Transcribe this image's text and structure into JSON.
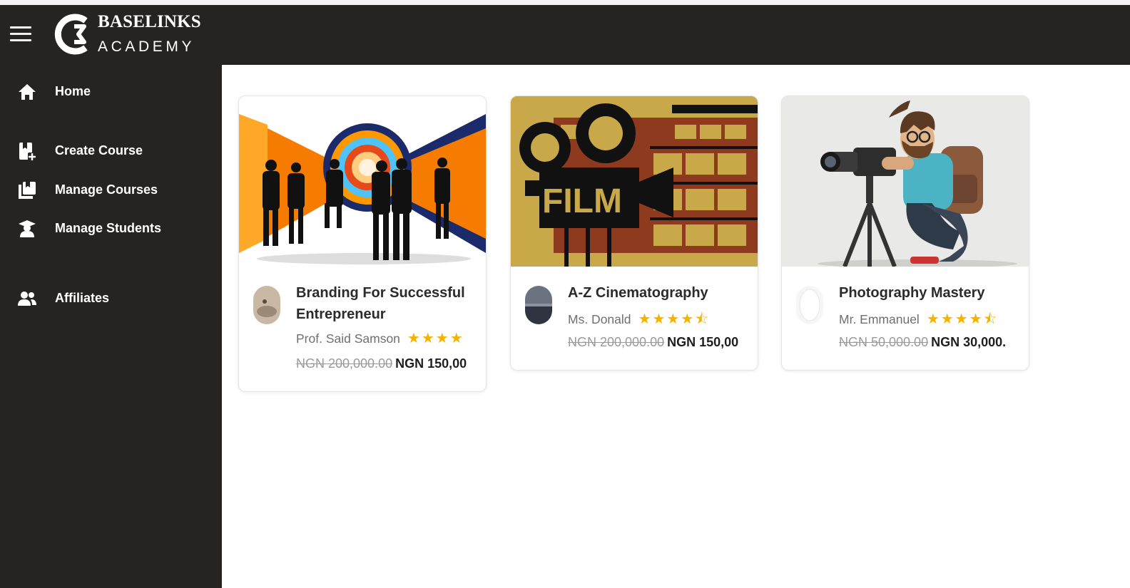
{
  "brand": {
    "line1": "BASELINKS",
    "line2": "ACADEMY"
  },
  "sidebar": {
    "items": [
      {
        "label": "Home",
        "icon": "home-icon"
      },
      {
        "label": "Create Course",
        "icon": "create-course-icon"
      },
      {
        "label": "Manage Courses",
        "icon": "manage-courses-icon"
      },
      {
        "label": "Manage Students",
        "icon": "manage-students-icon"
      },
      {
        "label": "Affiliates",
        "icon": "affiliates-icon"
      }
    ]
  },
  "courses": [
    {
      "title": "Branding For Successful Entrepreneur",
      "instructor": "Prof. Said Samson",
      "stars": "★★★★",
      "old_price": "NGN 200,000.00",
      "new_price": "NGN 150,00"
    },
    {
      "title": "A-Z Cinematography",
      "instructor": "Ms. Donald",
      "stars": "★★★★⯪",
      "old_price": "NGN 200,000.00",
      "new_price": "NGN 150,00",
      "image_text": "FILM"
    },
    {
      "title": "Photography Mastery",
      "instructor": "Mr. Emmanuel",
      "stars": "★★★★⯪",
      "old_price": "NGN 50,000.00",
      "new_price": "NGN 30,000."
    }
  ],
  "colors": {
    "header": "#252423",
    "star": "#f5b301",
    "accent_orange": "#f57c00",
    "accent_navy": "#1b2a6b"
  }
}
